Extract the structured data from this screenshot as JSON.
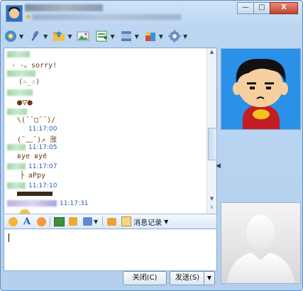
{
  "window": {
    "buttons": {
      "minimize": "—",
      "maximize": "□",
      "close": "X"
    }
  },
  "toolbar": {
    "items": [
      {
        "icon": "video-call-icon"
      },
      {
        "icon": "voice-call-icon"
      },
      {
        "icon": "send-file-icon"
      },
      {
        "icon": "image-icon"
      },
      {
        "icon": "application-icon"
      },
      {
        "icon": "group-icon"
      },
      {
        "icon": "game-icon"
      },
      {
        "icon": "settings-icon"
      }
    ]
  },
  "chat": {
    "messages": [
      {
        "text": "- -。sorry!"
      },
      {
        "text": "(☆_☆)"
      },
      {
        "text": "●▽●"
      },
      {
        "time": "11:17:00",
        "text": "\\(ˉˉ□ˉˉ)/"
      },
      {
        "time": "11:17:05",
        "text": "(ˉ﹏ˉ)↗ 涨"
      },
      {
        "time": "11:17:07",
        "text": "вyе вyё"
      },
      {
        "time": "11:17:10",
        "text": "├ aPpy"
      },
      {
        "time": "11:17:31",
        "text": ""
      }
    ]
  },
  "format_bar": {
    "history_label": "消息记录"
  },
  "actions": {
    "close_label": "关闭(C)",
    "send_label": "发送(S)"
  },
  "colors": {
    "accent": "#2a90e8",
    "timestamp": "#2a5db0",
    "message_text": "#6b3a10"
  }
}
